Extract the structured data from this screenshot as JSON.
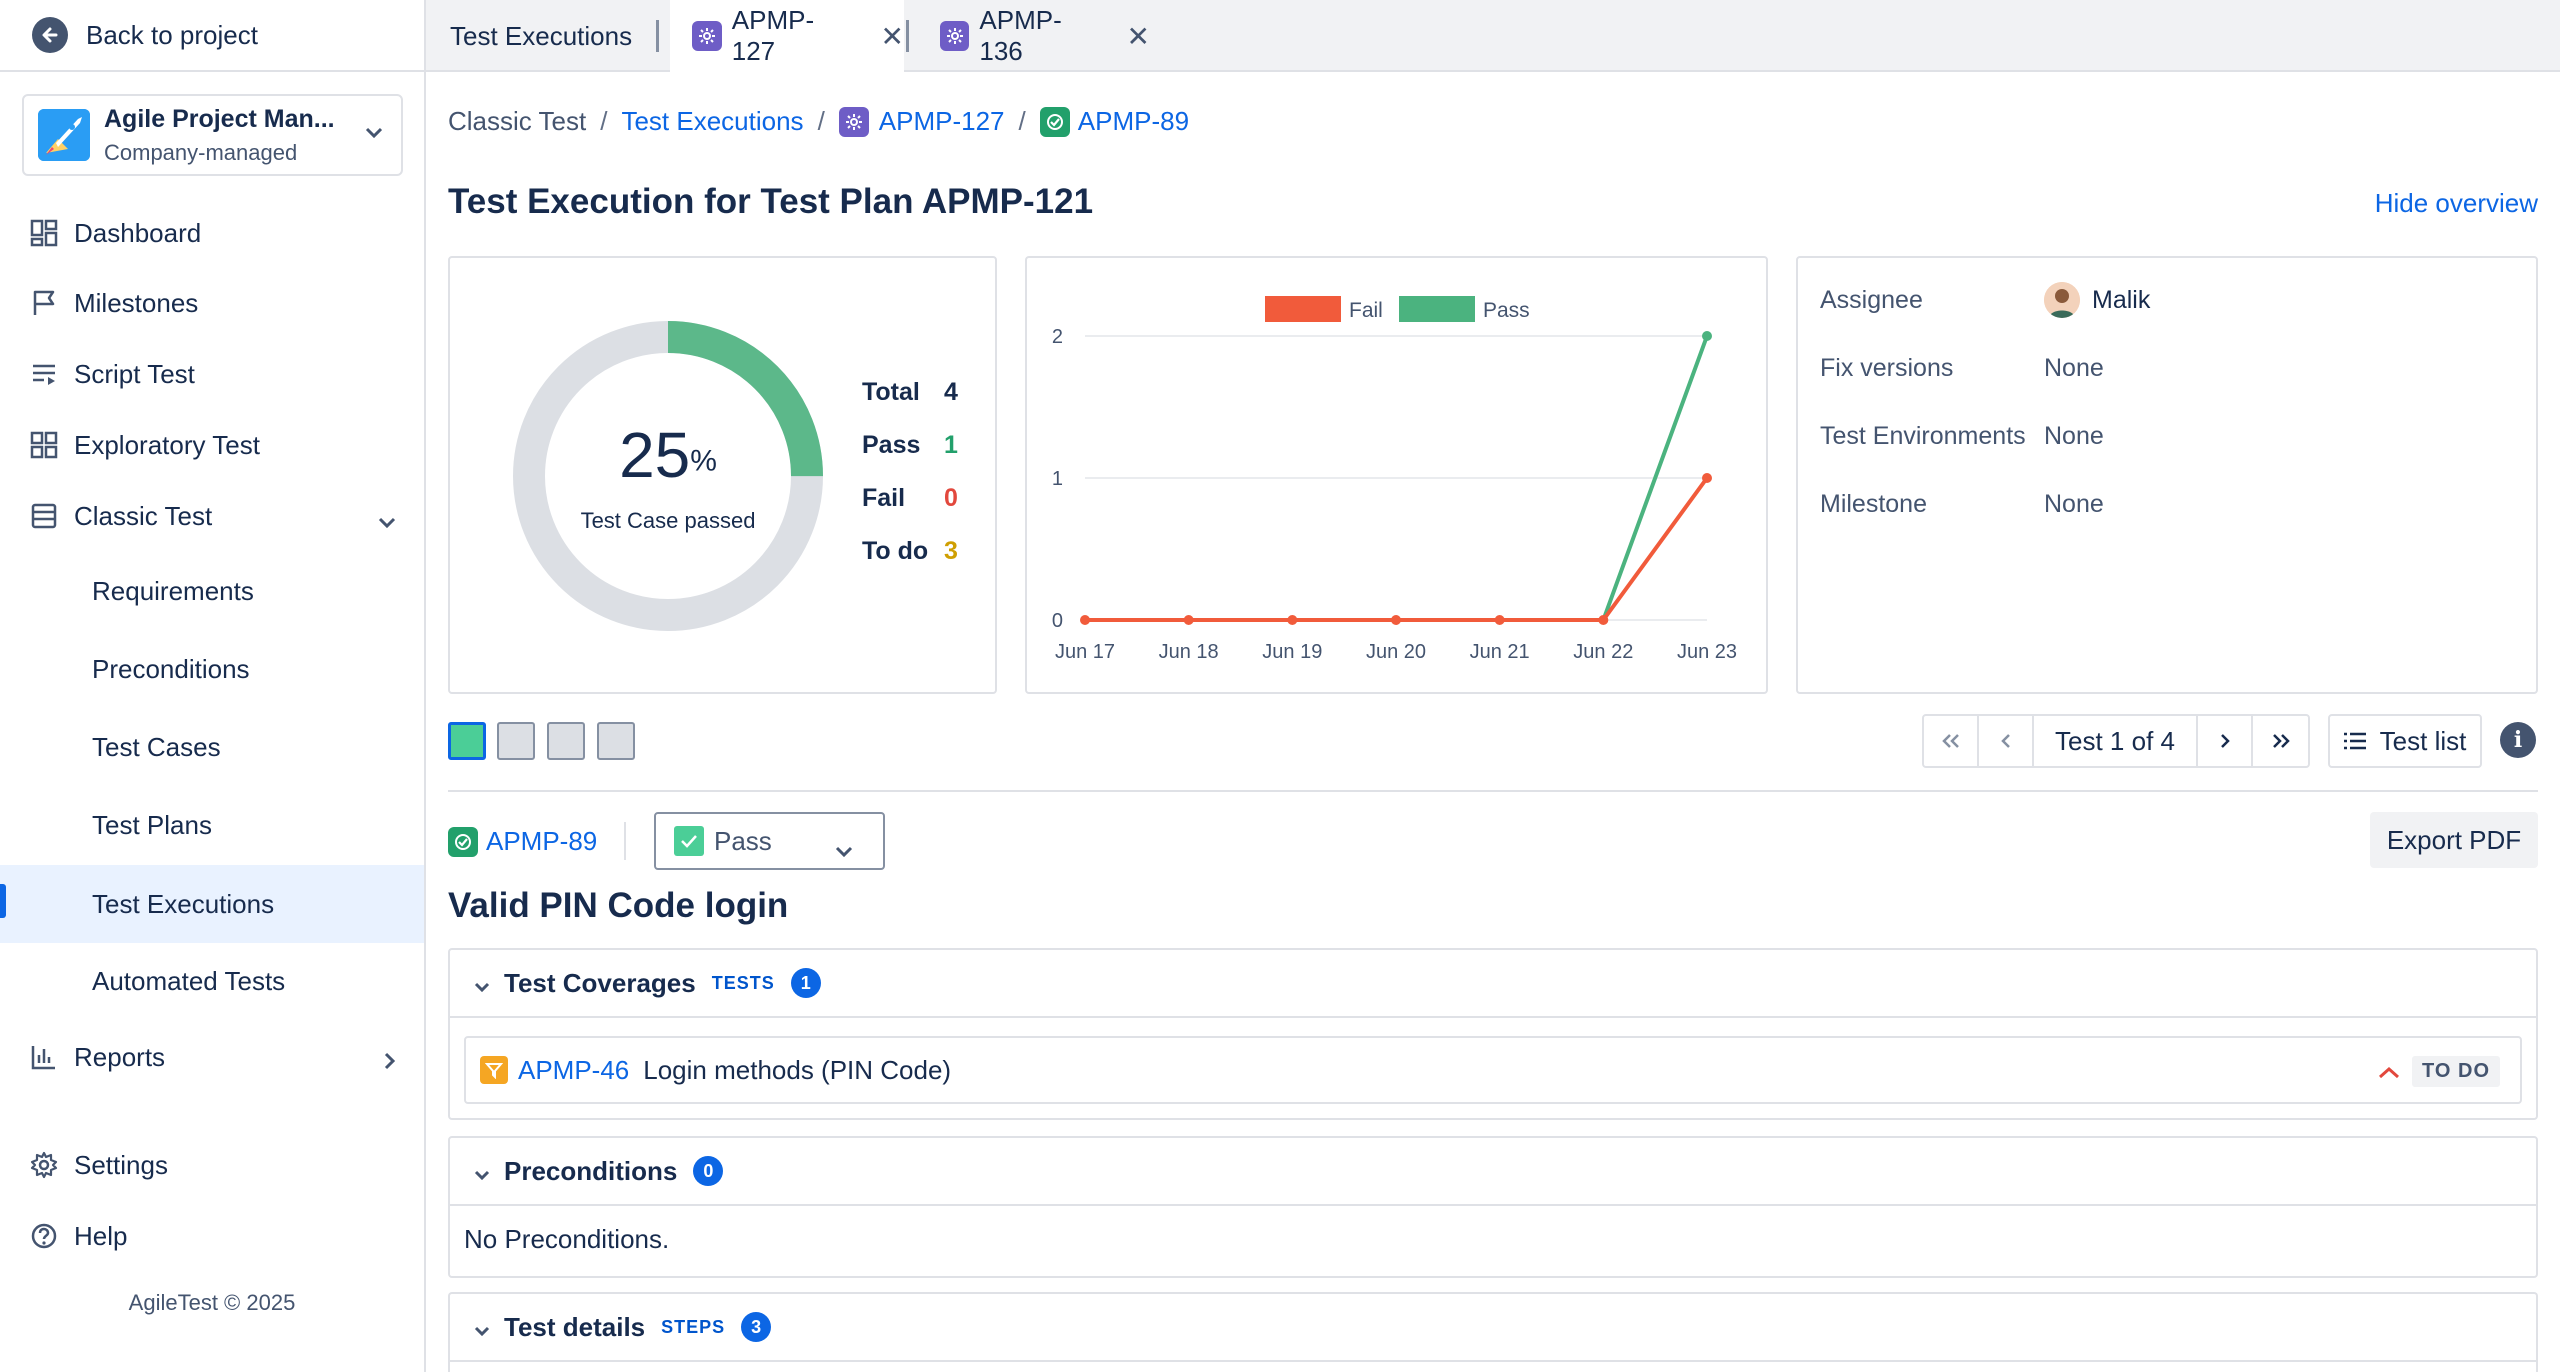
{
  "sidebar": {
    "back_label": "Back to project",
    "project_name": "Agile Project Man...",
    "project_type": "Company-managed",
    "items": [
      {
        "label": "Dashboard"
      },
      {
        "label": "Milestones"
      },
      {
        "label": "Script Test"
      },
      {
        "label": "Exploratory Test"
      },
      {
        "label": "Classic Test"
      },
      {
        "label": "Requirements"
      },
      {
        "label": "Preconditions"
      },
      {
        "label": "Test Cases"
      },
      {
        "label": "Test Plans"
      },
      {
        "label": "Test Executions"
      },
      {
        "label": "Automated Tests"
      },
      {
        "label": "Reports"
      },
      {
        "label": "Settings"
      },
      {
        "label": "Help"
      }
    ],
    "footer": "AgileTest © 2025"
  },
  "tabs": [
    {
      "label": "Test Executions"
    },
    {
      "label": "APMP-127"
    },
    {
      "label": "APMP-136"
    }
  ],
  "breadcrumb": {
    "root": "Classic Test",
    "level1": "Test Executions",
    "level2": "APMP-127",
    "level3": "APMP-89"
  },
  "page_title": "Test Execution for Test Plan APMP-121",
  "hide_overview": "Hide overview",
  "donut": {
    "percent": "25",
    "percent_sign": "%",
    "caption": "Test Case passed",
    "pass_fraction": 0.25,
    "stats": [
      {
        "label": "Total",
        "value": "4",
        "color": "#172b4d"
      },
      {
        "label": "Pass",
        "value": "1",
        "color": "#22a06b"
      },
      {
        "label": "Fail",
        "value": "0",
        "color": "#e2483d"
      },
      {
        "label": "To do",
        "value": "3",
        "color": "#cf9f02"
      }
    ]
  },
  "chart_data": {
    "type": "line",
    "x": [
      "Jun 17",
      "Jun 18",
      "Jun 19",
      "Jun 20",
      "Jun 21",
      "Jun 22",
      "Jun 23"
    ],
    "series": [
      {
        "name": "Fail",
        "color": "#f15b3b",
        "values": [
          0,
          0,
          0,
          0,
          0,
          0,
          1
        ]
      },
      {
        "name": "Pass",
        "color": "#4bb37f",
        "values": [
          0,
          0,
          0,
          0,
          0,
          0,
          2
        ]
      }
    ],
    "yticks": [
      "0",
      "1",
      "2"
    ],
    "ylim": [
      0,
      2
    ],
    "grid": true,
    "legend": "top-center"
  },
  "overview": {
    "assignee_label": "Assignee",
    "assignee_value": "Malik",
    "fix_versions_label": "Fix versions",
    "fix_versions_value": "None",
    "environments_label": "Test Environments",
    "environments_value": "None",
    "milestone_label": "Milestone",
    "milestone_value": "None"
  },
  "pager": {
    "text": "Test 1 of 4",
    "test_list": "Test list",
    "info": "i"
  },
  "test": {
    "key": "APMP-89",
    "status": "Pass",
    "export": "Export PDF",
    "title": "Valid PIN Code login"
  },
  "coverages": {
    "title": "Test Coverages",
    "tag": "TESTS",
    "count": "1",
    "item_key": "APMP-46",
    "item_title": "Login methods (PIN Code)",
    "item_status": "TO DO"
  },
  "preconditions": {
    "title": "Preconditions",
    "count": "0",
    "empty_text": "No Preconditions."
  },
  "details": {
    "title": "Test details",
    "tag": "STEPS",
    "count": "3"
  }
}
